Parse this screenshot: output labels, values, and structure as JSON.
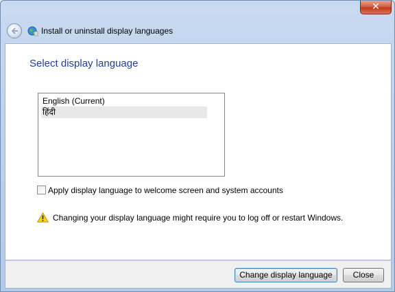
{
  "window": {
    "close_glyph": "✕"
  },
  "nav": {
    "title": "Install or uninstall display languages",
    "back_icon": "back-arrow-icon",
    "page_icon": "globe-icon"
  },
  "main": {
    "heading": "Select display language",
    "languages": [
      {
        "label": "English (Current)",
        "selected": false
      },
      {
        "label": "हिंदी",
        "selected": true
      }
    ],
    "apply_checkbox_label": "Apply display language to welcome screen and system accounts",
    "apply_checkbox_checked": false,
    "warning_text": "Changing your display language might require you to log off or restart Windows.",
    "warning_icon": "warning-icon"
  },
  "footer": {
    "change_button": "Change display language",
    "close_button": "Close"
  },
  "colors": {
    "heading": "#1e3f94",
    "selection": "#e8e8e8",
    "close_red": "#c33a1f"
  }
}
